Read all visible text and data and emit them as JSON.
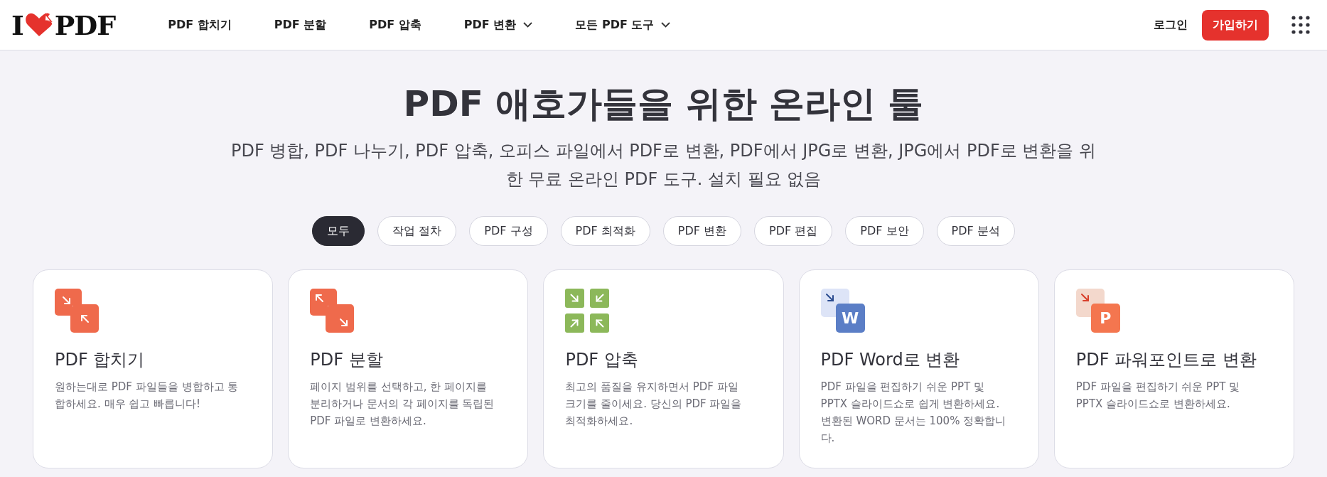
{
  "header": {
    "logo": {
      "left": "I",
      "right": "PDF"
    },
    "nav": [
      {
        "label": "PDF 합치기",
        "dropdown": false
      },
      {
        "label": "PDF 분할",
        "dropdown": false
      },
      {
        "label": "PDF 압축",
        "dropdown": false
      },
      {
        "label": "PDF 변환",
        "dropdown": true
      },
      {
        "label": "모든 PDF 도구",
        "dropdown": true
      }
    ],
    "login": "로그인",
    "signup": "가입하기"
  },
  "hero": {
    "title": "PDF 애호가들을 위한 온라인 툴",
    "subtitle": "PDF 병합, PDF 나누기, PDF 압축, 오피스 파일에서 PDF로 변환, PDF에서 JPG로 변환, JPG에서 PDF로 변환을 위한 무료 온라인 PDF 도구. 설치 필요 없음"
  },
  "filters": [
    {
      "label": "모두",
      "selected": true
    },
    {
      "label": "작업 절차",
      "selected": false
    },
    {
      "label": "PDF 구성",
      "selected": false
    },
    {
      "label": "PDF 최적화",
      "selected": false
    },
    {
      "label": "PDF 변환",
      "selected": false
    },
    {
      "label": "PDF 편집",
      "selected": false
    },
    {
      "label": "PDF 보안",
      "selected": false
    },
    {
      "label": "PDF 분석",
      "selected": false
    }
  ],
  "tools": [
    {
      "kind": "merge",
      "title": "PDF 합치기",
      "description": "원하는대로 PDF 파일들을 병합하고 통합하세요. 매우 쉽고 빠릅니다!"
    },
    {
      "kind": "split",
      "title": "PDF 분할",
      "description": "페이지 범위를 선택하고, 한 페이지를 분리하거나 문서의 각 페이지를 독립된 PDF 파일로 변환하세요."
    },
    {
      "kind": "compress",
      "title": "PDF 압축",
      "description": "최고의 품질을 유지하면서 PDF 파일 크기를 줄이세요. 당신의 PDF 파일을 최적화하세요."
    },
    {
      "kind": "word",
      "badge": "W",
      "title": "PDF Word로 변환",
      "description": "PDF 파일을 편집하기 쉬운 PPT 및 PPTX 슬라이드쇼로 쉽게 변환하세요. 변환된 WORD 문서는 100% 정확합니다."
    },
    {
      "kind": "ppt",
      "badge": "P",
      "title": "PDF 파워포인트로 변환",
      "description": "PDF 파일을 편집하기 쉬운 PPT 및 PPTX 슬라이드쇼로 변환하세요."
    }
  ]
}
